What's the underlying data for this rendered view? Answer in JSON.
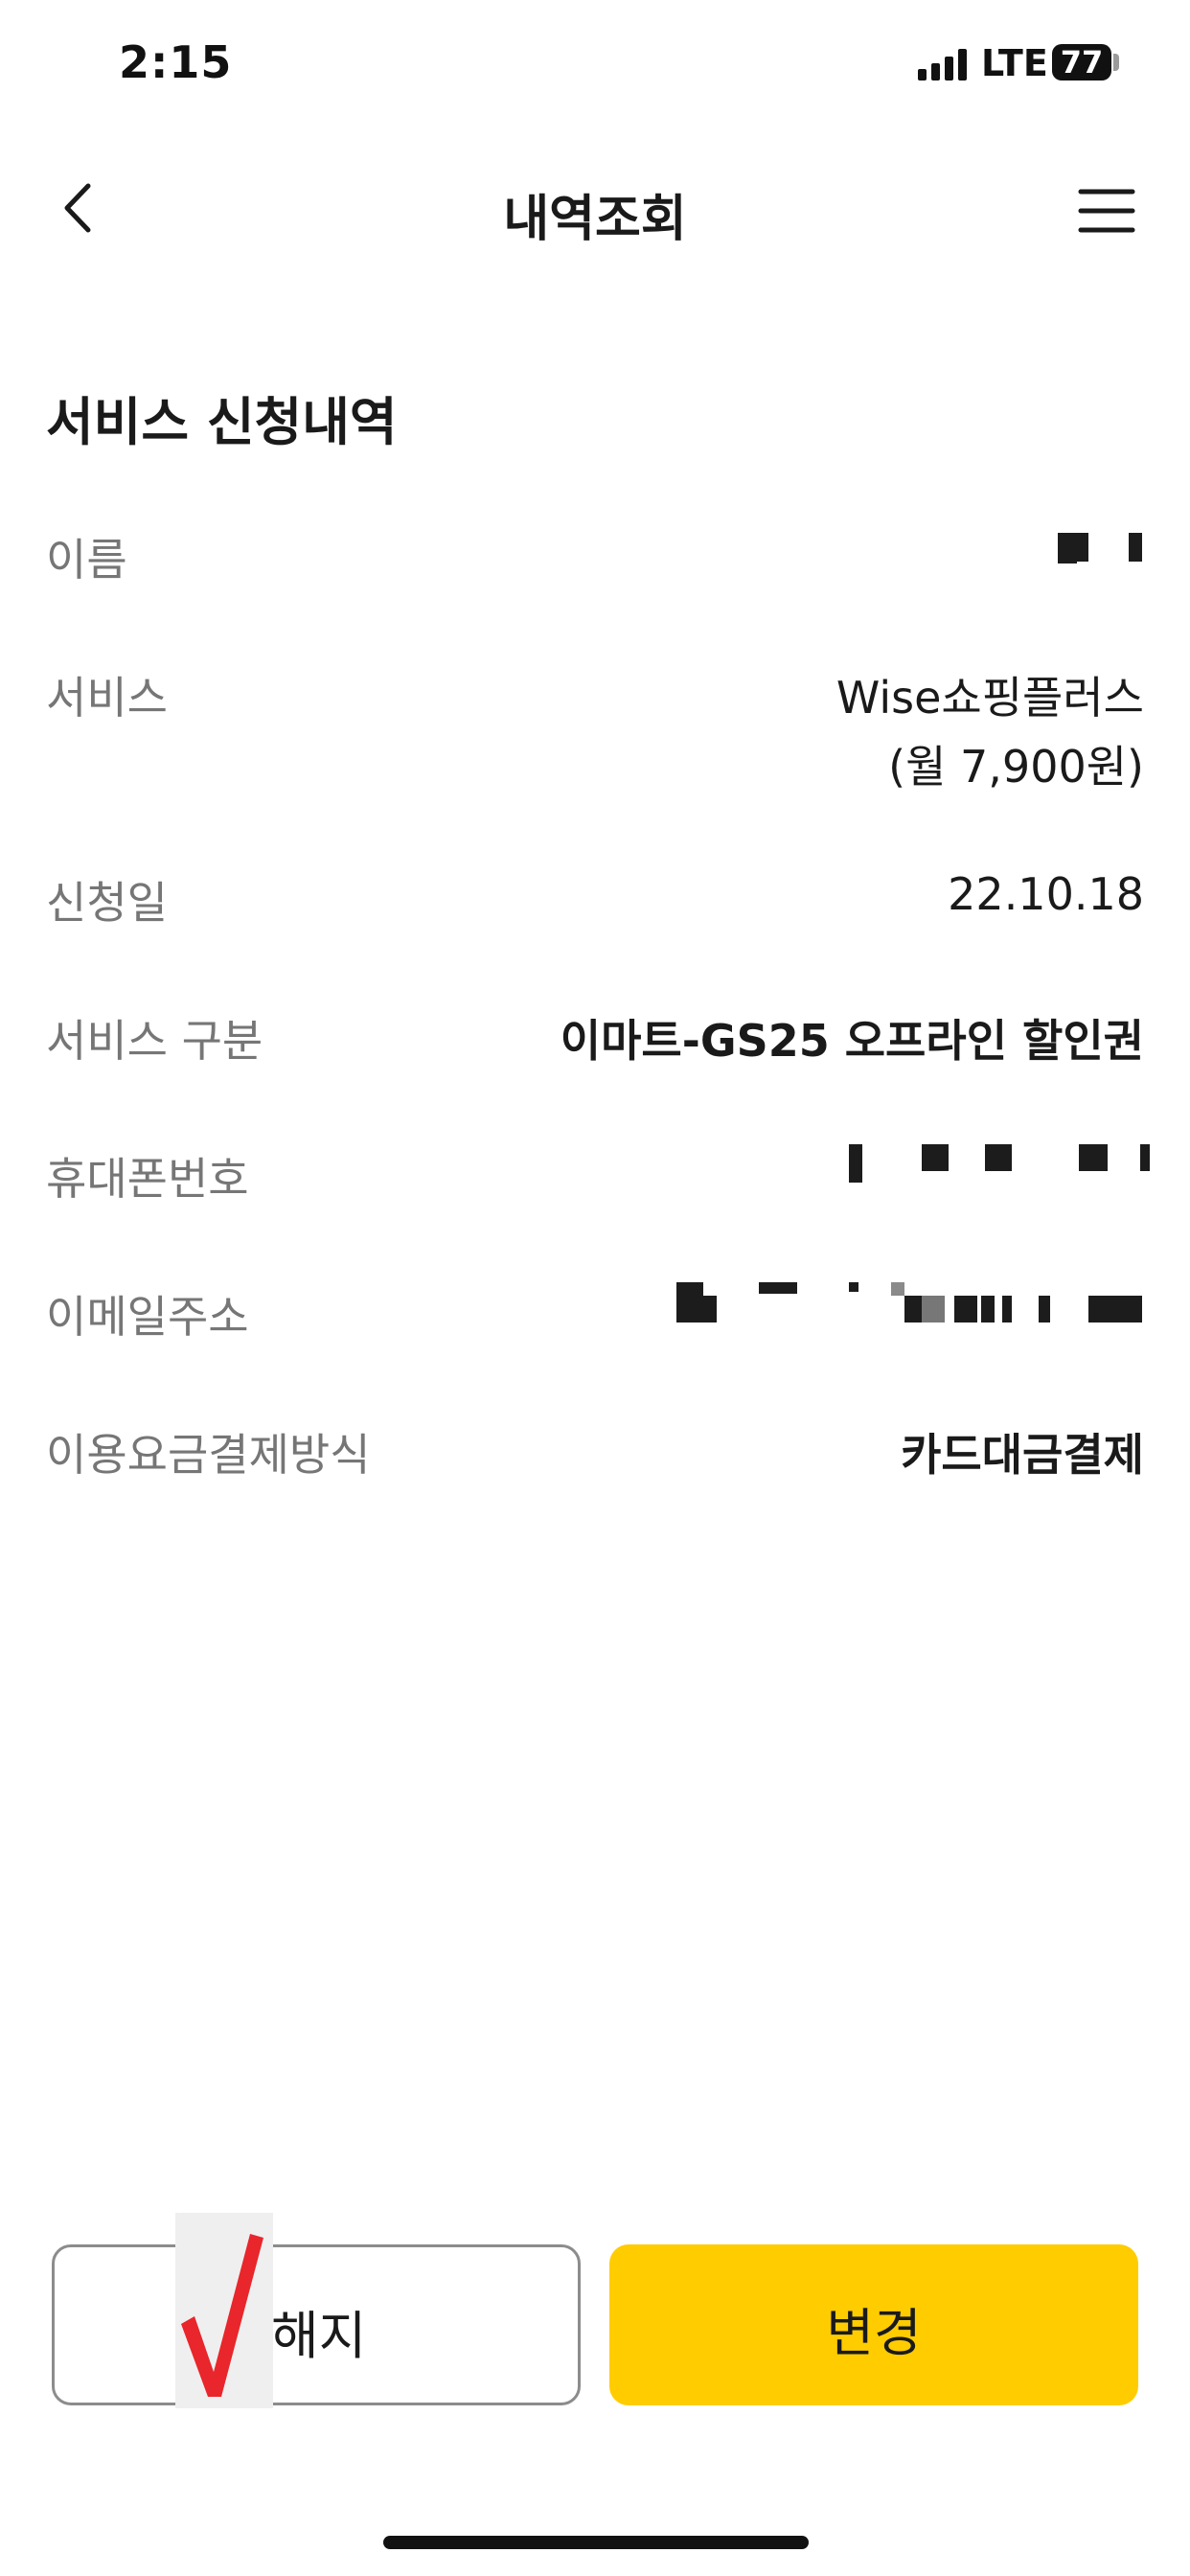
{
  "status_bar": {
    "time": "2:15",
    "network": "LTE",
    "battery": "77"
  },
  "header": {
    "title": "내역조회",
    "back_icon": "chevron-left-icon",
    "menu_icon": "hamburger-menu-icon"
  },
  "section": {
    "title": "서비스 신청내역",
    "rows": [
      {
        "label": "이름",
        "value": ""
      },
      {
        "label": "서비스",
        "value_lines": [
          "Wise쇼핑플러스",
          "(월 7,900원)"
        ]
      },
      {
        "label": "신청일",
        "value": "22.10.18"
      },
      {
        "label": "서비스 구분",
        "value": "이마트-GS25 오프라인 할인권"
      },
      {
        "label": "휴대폰번호",
        "value": ""
      },
      {
        "label": "이메일주소",
        "value": ""
      },
      {
        "label": "이용요금결제방식",
        "value": "카드대금결제"
      }
    ]
  },
  "buttons": {
    "cancel_label": "해지",
    "change_label": "변경"
  },
  "colors": {
    "accent": "#ffcc00",
    "check_mark": "#e8262b",
    "label_gray": "#767676",
    "text": "#1a1a1a"
  }
}
